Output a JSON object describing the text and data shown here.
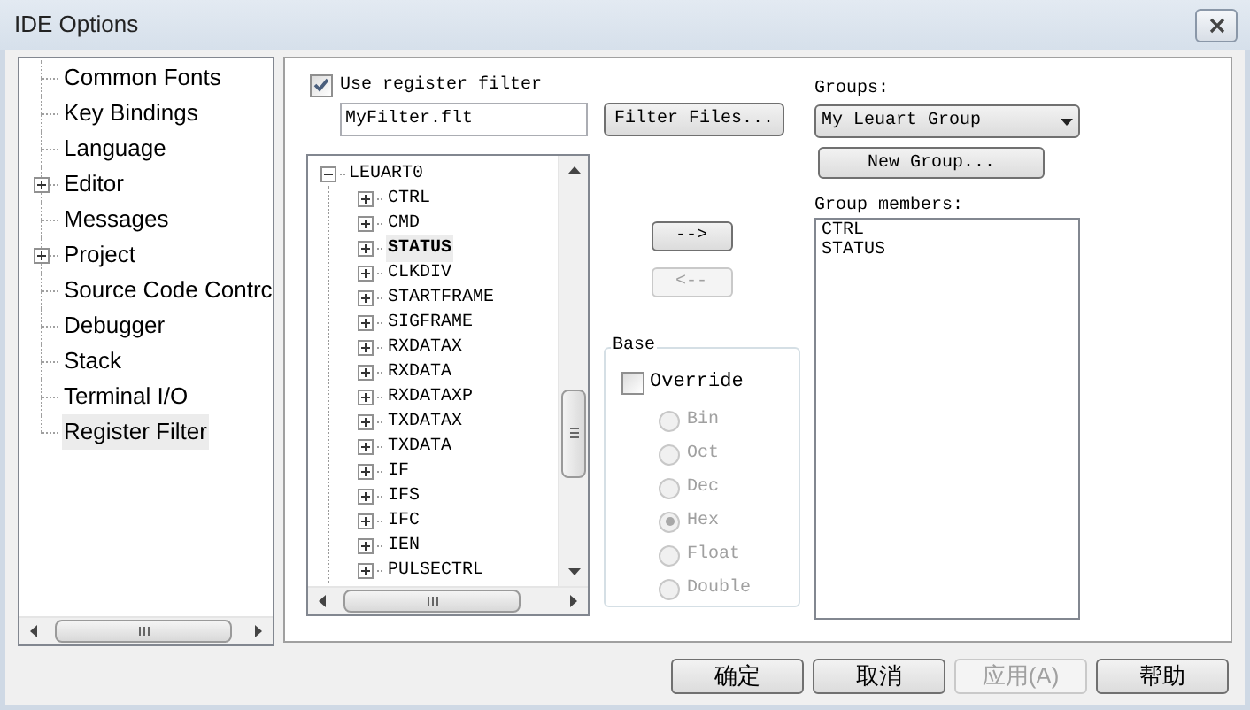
{
  "window": {
    "title": "IDE Options"
  },
  "sidebar": {
    "items": [
      {
        "label": "Common Fonts",
        "selected": false
      },
      {
        "label": "Key Bindings",
        "selected": false
      },
      {
        "label": "Language",
        "selected": false
      },
      {
        "label": "Editor",
        "selected": false,
        "expanded": false
      },
      {
        "label": "Messages",
        "selected": false
      },
      {
        "label": "Project",
        "selected": false,
        "expanded": false
      },
      {
        "label": "Source Code Contrc",
        "selected": false
      },
      {
        "label": "Debugger",
        "selected": false
      },
      {
        "label": "Stack",
        "selected": false
      },
      {
        "label": "Terminal I/O",
        "selected": false
      },
      {
        "label": "Register Filter",
        "selected": true
      }
    ]
  },
  "register_filter": {
    "use_filter": {
      "label": "Use register filter",
      "checked": true
    },
    "filter_file": {
      "value": "MyFilter.flt"
    },
    "filter_files_button": "Filter Files...",
    "tree": [
      {
        "label": "LEUART0",
        "expanded": true,
        "selected": false,
        "children": [
          {
            "label": "CTRL",
            "expanded": false,
            "selected": false
          },
          {
            "label": "CMD",
            "expanded": false,
            "selected": false
          },
          {
            "label": "STATUS",
            "expanded": false,
            "selected": true
          },
          {
            "label": "CLKDIV",
            "expanded": false,
            "selected": false
          },
          {
            "label": "STARTFRAME",
            "expanded": false,
            "selected": false
          },
          {
            "label": "SIGFRAME",
            "expanded": false,
            "selected": false
          },
          {
            "label": "RXDATAX",
            "expanded": false,
            "selected": false
          },
          {
            "label": "RXDATA",
            "expanded": false,
            "selected": false
          },
          {
            "label": "RXDATAXP",
            "expanded": false,
            "selected": false
          },
          {
            "label": "TXDATAX",
            "expanded": false,
            "selected": false
          },
          {
            "label": "TXDATA",
            "expanded": false,
            "selected": false
          },
          {
            "label": "IF",
            "expanded": false,
            "selected": false
          },
          {
            "label": "IFS",
            "expanded": false,
            "selected": false
          },
          {
            "label": "IFC",
            "expanded": false,
            "selected": false
          },
          {
            "label": "IEN",
            "expanded": false,
            "selected": false
          },
          {
            "label": "PULSECTRL",
            "expanded": false,
            "selected": false
          }
        ]
      }
    ],
    "add_button": {
      "label": "-->",
      "disabled": false
    },
    "remove_button": {
      "label": "<--",
      "disabled": true
    },
    "base": {
      "title": "Base",
      "override": {
        "label": "Override",
        "checked": false
      },
      "options": [
        {
          "label": "Bin",
          "selected": false,
          "disabled": true
        },
        {
          "label": "Oct",
          "selected": false,
          "disabled": true
        },
        {
          "label": "Dec",
          "selected": false,
          "disabled": true
        },
        {
          "label": "Hex",
          "selected": true,
          "disabled": true
        },
        {
          "label": "Float",
          "selected": false,
          "disabled": true
        },
        {
          "label": "Double",
          "selected": false,
          "disabled": true
        }
      ]
    },
    "groups": {
      "label": "Groups:",
      "value": "My Leuart Group",
      "new_group_button": "New Group...",
      "members_label": "Group members:",
      "members": [
        "CTRL",
        "STATUS"
      ]
    }
  },
  "buttons": [
    {
      "label": "确定",
      "disabled": false
    },
    {
      "label": "取消",
      "disabled": false
    },
    {
      "label": "应用(A)",
      "disabled": true
    },
    {
      "label": "帮助",
      "disabled": false
    }
  ]
}
